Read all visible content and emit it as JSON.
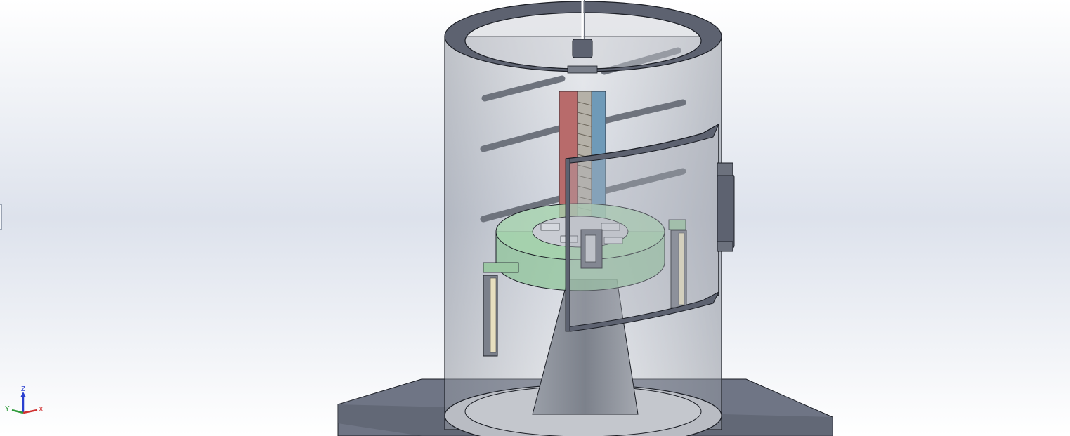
{
  "viewport": {
    "background": {
      "top": "#ffffff",
      "band": "#dde2ec",
      "bottom": "#ffffff"
    }
  },
  "model": {
    "colors": {
      "base_plate": "#6f7585",
      "cylinder_glass": "#9ea3ad",
      "rim": "#5d6270",
      "outline": "#1c1f26",
      "red_column": "#b86b6b",
      "blue_column": "#6f9ab8",
      "green_disc": "#8fc49a",
      "cone": "#8e939c",
      "cream_bar": "#e7dfbf"
    }
  },
  "triad": {
    "x_label": "X",
    "y_label": "Y",
    "z_label": "Z",
    "colors": {
      "x": "#d03030",
      "y": "#2f9a3a",
      "z": "#2a3fd0"
    }
  },
  "side_tab": {
    "icon": "collapse-tab-icon"
  }
}
